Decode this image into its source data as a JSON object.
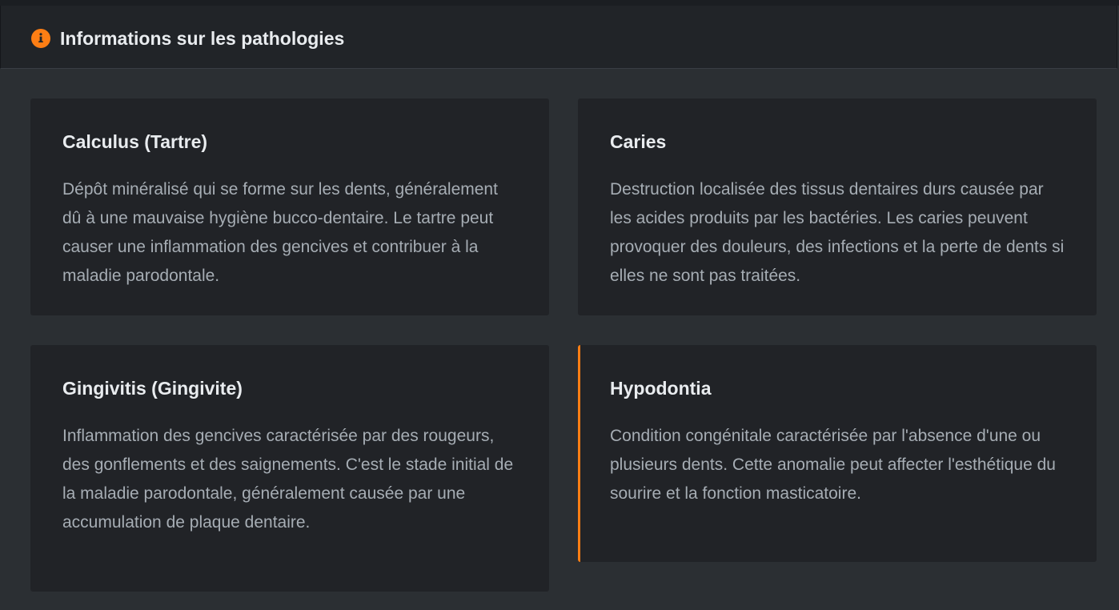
{
  "header": {
    "title": "Informations sur les pathologies",
    "icon": "info-icon",
    "icon_color": "#fd7e14"
  },
  "cards": [
    {
      "title": "Calculus (Tartre)",
      "description": "Dépôt minéralisé qui se forme sur les dents, généralement dû à une mauvaise hygiène bucco-dentaire. Le tartre peut causer une inflammation des gencives et contribuer à la maladie parodontale."
    },
    {
      "title": "Caries",
      "description": "Destruction localisée des tissus dentaires durs causée par les acides produits par les bactéries. Les caries peuvent provoquer des douleurs, des infections et la perte de dents si elles ne sont pas traitées."
    },
    {
      "title": "Gingivitis (Gingivite)",
      "description": "Inflammation des gencives caractérisée par des rougeurs, des gonflements et des saignements. C'est le stade initial de la maladie parodontale, généralement causée par une accumulation de plaque dentaire."
    },
    {
      "title": "Hypodontia",
      "description": "Condition congénitale caractérisée par l'absence d'une ou plusieurs dents. Cette anomalie peut affecter l'esthétique du sourire et la fonction masticatoire.",
      "highlight_color": "#fd7e14"
    }
  ]
}
